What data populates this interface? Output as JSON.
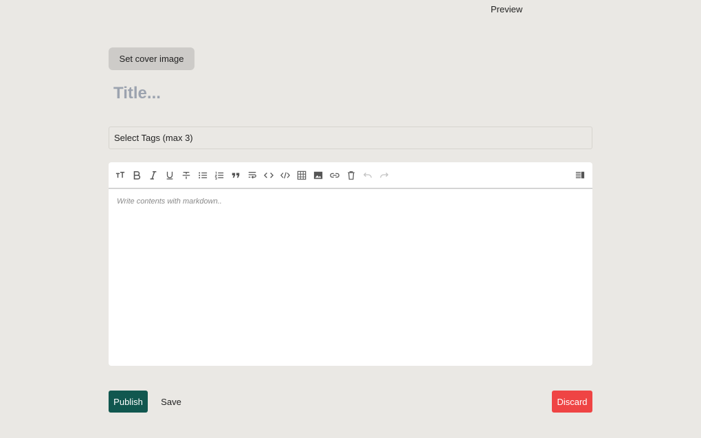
{
  "header": {
    "preview_label": "Preview"
  },
  "cover": {
    "button_label": "Set cover image"
  },
  "title": {
    "placeholder": "Title...",
    "value": ""
  },
  "tags": {
    "placeholder": "Select Tags (max 3)"
  },
  "editor": {
    "placeholder": "Write contents with markdown..",
    "value": "",
    "toolbar": [
      {
        "name": "heading-icon",
        "title": "Heading"
      },
      {
        "name": "bold-icon",
        "title": "Bold"
      },
      {
        "name": "italic-icon",
        "title": "Italic"
      },
      {
        "name": "underline-icon",
        "title": "Underline"
      },
      {
        "name": "strikethrough-icon",
        "title": "Strikethrough"
      },
      {
        "name": "bullet-list-icon",
        "title": "Unordered list"
      },
      {
        "name": "numbered-list-icon",
        "title": "Ordered list"
      },
      {
        "name": "quote-icon",
        "title": "Quote"
      },
      {
        "name": "wrap-icon",
        "title": "Line break"
      },
      {
        "name": "code-icon",
        "title": "Inline code"
      },
      {
        "name": "code-block-icon",
        "title": "Code block"
      },
      {
        "name": "table-icon",
        "title": "Table"
      },
      {
        "name": "image-icon",
        "title": "Image"
      },
      {
        "name": "link-icon",
        "title": "Link"
      },
      {
        "name": "trash-icon",
        "title": "Clear"
      },
      {
        "name": "undo-icon",
        "title": "Undo"
      },
      {
        "name": "redo-icon",
        "title": "Redo"
      },
      {
        "name": "preview-toggle-icon",
        "title": "Toggle preview"
      }
    ]
  },
  "actions": {
    "publish_label": "Publish",
    "save_label": "Save",
    "discard_label": "Discard"
  },
  "colors": {
    "background": "#eae8e4",
    "publish": "#11574f",
    "discard": "#ef4444",
    "cover_button": "#cdcbc8"
  }
}
